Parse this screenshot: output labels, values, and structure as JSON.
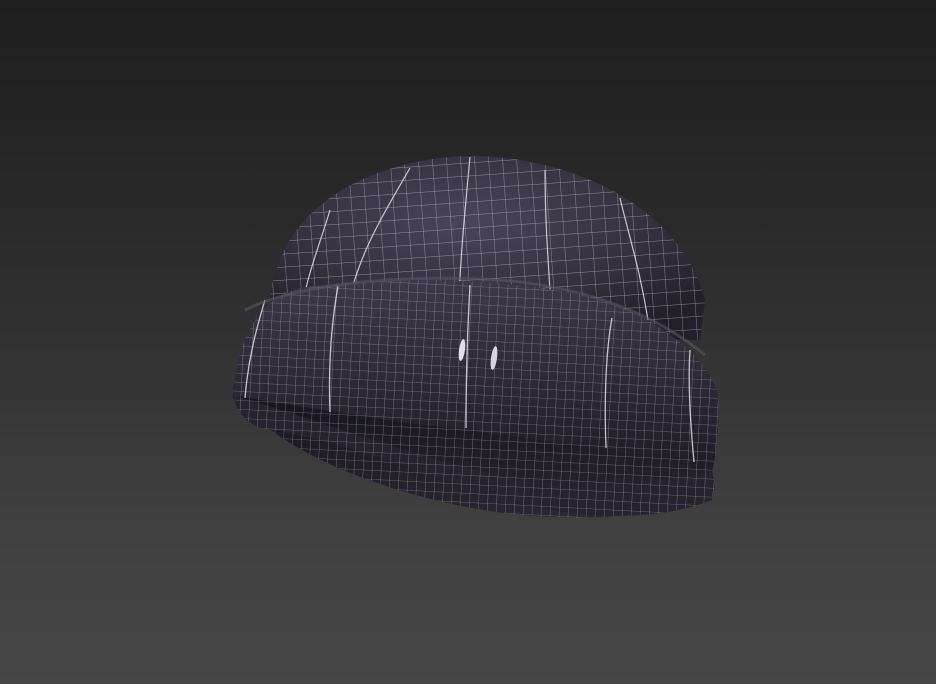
{
  "viewport": {
    "background_top": "#1e1e1e",
    "background_bottom": "#474747",
    "shading_mode": "smooth-shaded-with-wireframe-overlay"
  },
  "model": {
    "object": "beanie-hat",
    "surface_color": "#34303e",
    "surface_highlight": "#4a4458",
    "wire_color": "#d2ced8",
    "cuff_shadow": "#1a1720"
  }
}
